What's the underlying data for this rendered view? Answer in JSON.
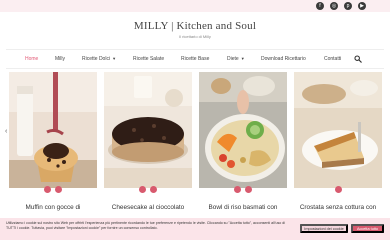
{
  "site": {
    "title": "MILLY | Kitchen and Soul",
    "tagline": "Il ricettario di Milly"
  },
  "social": [
    {
      "icon": "facebook-icon",
      "glyph": "f"
    },
    {
      "icon": "instagram-icon",
      "glyph": "◎"
    },
    {
      "icon": "pinterest-icon",
      "glyph": "p"
    },
    {
      "icon": "youtube-icon",
      "glyph": "▶"
    }
  ],
  "nav": {
    "items": [
      {
        "label": "Home",
        "active": true,
        "dropdown": false
      },
      {
        "label": "Milly",
        "active": false,
        "dropdown": false
      },
      {
        "label": "Ricette Dolci",
        "active": false,
        "dropdown": true
      },
      {
        "label": "Ricette Salate",
        "active": false,
        "dropdown": false
      },
      {
        "label": "Ricette Base",
        "active": false,
        "dropdown": false
      },
      {
        "label": "Diete",
        "active": false,
        "dropdown": true
      },
      {
        "label": "Download Ricettario",
        "active": false,
        "dropdown": false
      },
      {
        "label": "Contatti",
        "active": false,
        "dropdown": false
      }
    ],
    "search_icon": "search-icon",
    "active_color": "#e35c78"
  },
  "slider": {
    "prev": "‹",
    "next": "›",
    "posts": [
      {
        "title": "Muffin con gocce di",
        "dots": 2
      },
      {
        "title": "Cheesecake al cioccolato",
        "dots": 2
      },
      {
        "title": "Bowl di riso basmati con",
        "dots": 2
      },
      {
        "title": "Crostata senza cottura con",
        "dots": 1
      }
    ]
  },
  "cookie": {
    "text": "Utilizziamo i cookie sul nostro sito Web per offrirti l'esperienza più pertinente ricordando le tue preferenze e ripetendo le visite. Cliccando su \"Accetta tutto\", acconsenti all'uso di TUTTI i cookie. Tuttavia, puoi visitare \"Impostazioni cookie\" per fornire un consenso controllato.",
    "settings_label": "Impostazioni dei cookie",
    "accept_label": "Accetta tutto"
  },
  "colors": {
    "accent": "#d85a6e",
    "topbar": "#fbeef1",
    "cookie_bg": "#fbe4e9"
  }
}
